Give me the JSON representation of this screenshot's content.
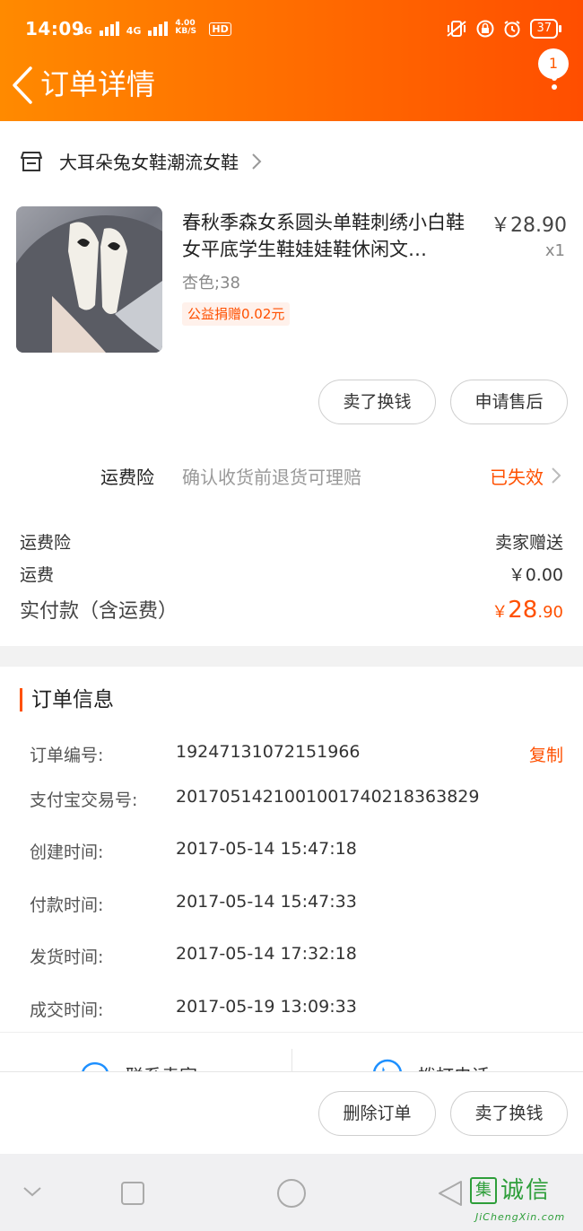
{
  "status_bar": {
    "time": "14:09",
    "network_1": "4G",
    "network_2": "4G",
    "speed": "4.00 KB/S",
    "hd": "HD",
    "battery": "37"
  },
  "nav": {
    "title": "订单详情",
    "badge_count": "1"
  },
  "shop": {
    "name": "大耳朵兔女鞋潮流女鞋"
  },
  "product": {
    "title": "春秋季森女系圆头单鞋刺绣小白鞋女平底学生鞋娃娃鞋休闲文…",
    "price": "￥28.90",
    "quantity": "x1",
    "sku": "杏色;38",
    "charity": "公益捐赠0.02元"
  },
  "item_actions": {
    "sell_label": "卖了换钱",
    "after_sale_label": "申请售后"
  },
  "insurance": {
    "label": "运费险",
    "description": "确认收货前退货可理赔",
    "status": "已失效"
  },
  "fees": {
    "insurance_label": "运费险",
    "insurance_value": "卖家赠送",
    "shipping_label": "运费",
    "shipping_value": "￥0.00",
    "total_label": "实付款（含运费）",
    "total_currency": "￥",
    "total_int": "28",
    "total_dec": ".90"
  },
  "order_info": {
    "title": "订单信息",
    "copy_label": "复制",
    "rows": [
      {
        "label": "订单编号:",
        "value": "19247131072151966"
      },
      {
        "label": "支付宝交易号:",
        "value": "2017051421001001740218363829"
      },
      {
        "label": "创建时间:",
        "value": "2017-05-14 15:47:18"
      },
      {
        "label": "付款时间:",
        "value": "2017-05-14 15:47:33"
      },
      {
        "label": "发货时间:",
        "value": "2017-05-14 17:32:18"
      },
      {
        "label": "成交时间:",
        "value": "2017-05-19 13:09:33"
      }
    ]
  },
  "contact": {
    "seller_label": "联系卖家",
    "phone_label": "拨打电话"
  },
  "bottom_actions": {
    "delete_label": "删除订单",
    "sell_label": "卖了换钱"
  },
  "watermark": {
    "mark": "集",
    "text": "诚信",
    "url": "JiChengXin.com"
  },
  "colors": {
    "accent": "#ff5000",
    "header_start": "#ff8a00",
    "header_end": "#ff4e00"
  }
}
